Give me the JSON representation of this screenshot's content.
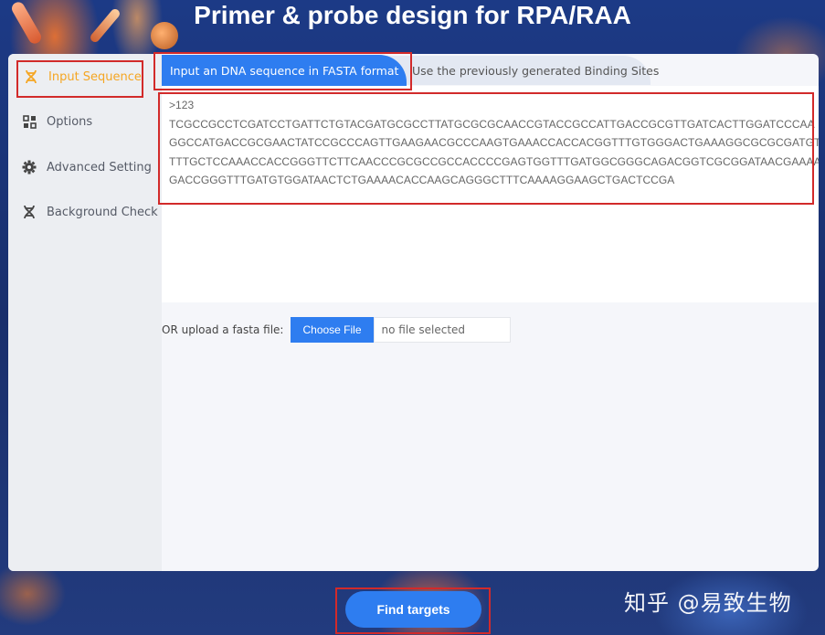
{
  "page": {
    "title": "Primer & probe design for RPA/RAA",
    "watermark": "知乎 @易致生物"
  },
  "sidebar": {
    "items": [
      {
        "label": "Input Sequence",
        "icon": "dna-icon",
        "active": true
      },
      {
        "label": "Options",
        "icon": "grid-icon",
        "active": false
      },
      {
        "label": "Advanced Setting",
        "icon": "gear-icon",
        "active": false
      },
      {
        "label": "Background Check",
        "icon": "dna-icon",
        "active": false
      }
    ]
  },
  "tabs": {
    "active_label": "Input an DNA sequence in FASTA format",
    "inactive_label": "Use the previously generated Binding Sites"
  },
  "editor": {
    "sequence_text": ">123\nTCGCCGCCTCGATCCTGATTCTGTACGATGCGCCTTATGCGCGCAACCGTACCGCCATTGACCGCGTTGATCACTTGGATCCCAA\nGGCCATGACCGCGAACTATCCGCCCAGTTGAAGAACGCCCAAGTGAAACCACCACGGTTTGTGGGACTGAAAGGCGCGCGATGT\nTTTGCTCCAAACCACCGGGTTCTTCAACCCGCGCCGCCACCCCGAGTGGTTTGATGGCGGGCAGACGGTCGCGGATAACGAAAA\nGACCGGGTTTGATGTGGATAACTCTGAAAACACCAAGCAGGGCTTTCAAAAGGAAGCTGACTCCGA"
  },
  "upload": {
    "label": "OR upload a fasta file:",
    "button_label": "Choose File",
    "file_status": "no file selected"
  },
  "actions": {
    "find_label": "Find targets"
  },
  "colors": {
    "accent": "#2e7df0",
    "active_sidebar": "#f5a623",
    "highlight_box": "#d22a2a"
  }
}
